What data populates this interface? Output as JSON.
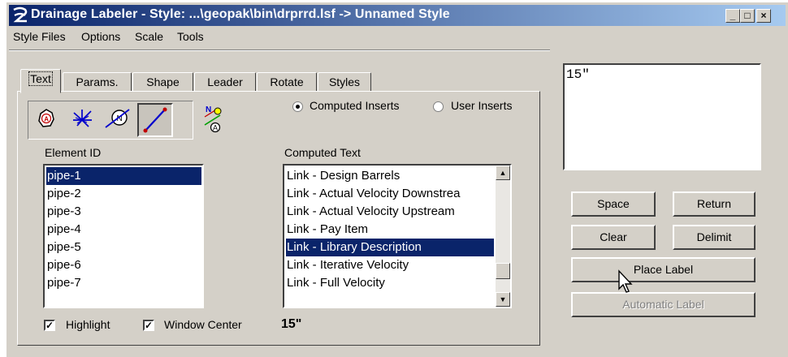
{
  "window": {
    "title": "Drainage Labeler - Style: ...\\geopak\\bin\\drprrd.lsf -> Unnamed Style",
    "controls": [
      "_",
      "□",
      "×"
    ]
  },
  "menu": [
    "Style Files",
    "Options",
    "Scale",
    "Tools"
  ],
  "tabs": [
    "Text",
    "Params.",
    "Shape",
    "Leader",
    "Rotate",
    "Styles"
  ],
  "active_tab": "Text",
  "tools": [
    "node-tool-icon",
    "outfall-tool-icon",
    "network-tool-icon",
    "link-tool-icon",
    "label-update-icon"
  ],
  "inserts": {
    "computed_label": "Computed Inserts",
    "user_label": "User Inserts",
    "selected": "Computed Inserts"
  },
  "element_id": {
    "heading": "Element ID",
    "items": [
      "pipe-1",
      "pipe-2",
      "pipe-3",
      "pipe-4",
      "pipe-5",
      "pipe-6",
      "pipe-7"
    ],
    "selected": "pipe-1"
  },
  "computed_text": {
    "heading": "Computed Text",
    "items": [
      "Link - Design Barrels",
      "Link - Actual Velocity Downstrea",
      "Link - Actual Velocity Upstream",
      "Link - Pay Item",
      "Link - Library Description",
      "Link - Iterative Velocity",
      "Link - Full Velocity"
    ],
    "selected": "Link - Library Description"
  },
  "options": {
    "highlight_label": "Highlight",
    "highlight_checked": true,
    "window_center_label": "Window Center",
    "window_center_checked": true,
    "preview_value": "15\""
  },
  "label_text": "15\"",
  "buttons": {
    "space": "Space",
    "return": "Return",
    "clear": "Clear",
    "delimit": "Delimit",
    "place_label": "Place Label",
    "automatic_label": "Automatic Label"
  },
  "colors": {
    "title_start": "#0a246a",
    "title_end": "#a6caf0",
    "selection": "#0a246a",
    "face": "#d4d0c8"
  }
}
